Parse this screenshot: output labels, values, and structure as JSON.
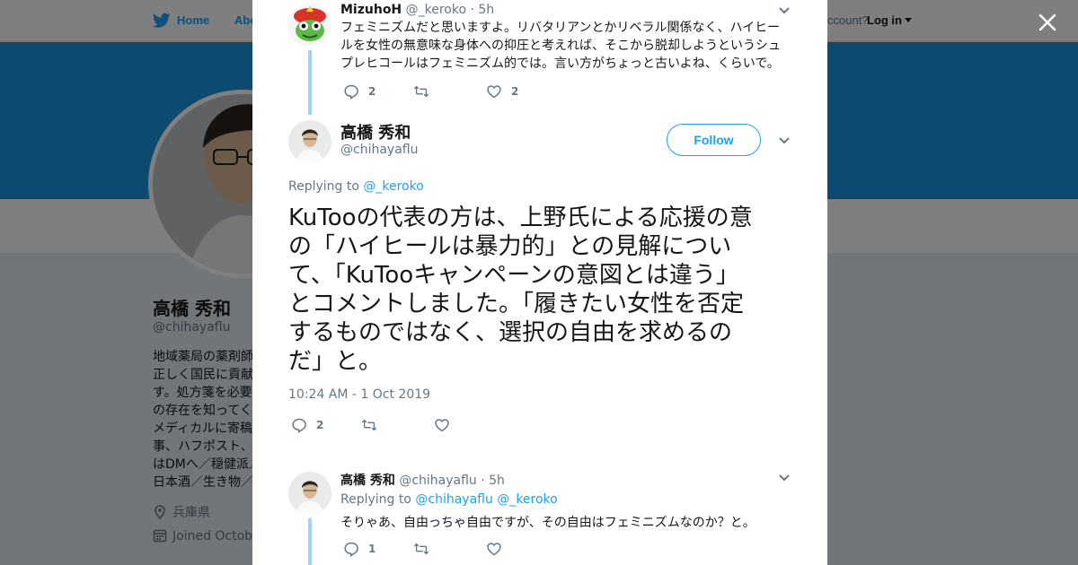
{
  "nav": {
    "home_label": "Home",
    "about_label": "Abo",
    "account_prompt": "ccount?",
    "login_label": "Log in"
  },
  "profile": {
    "name": "高橋 秀和",
    "handle": "@chihayaflu",
    "bio_lines": [
      "地域薬局の薬剤師",
      "正しく国民に貢献",
      "す。処方箋を必要",
      "の存在を知ってく",
      "メディカルに寄稿",
      "事、ハフポスト、",
      "はDMへ／穏健派／",
      "日本酒／生き物／"
    ],
    "location": "兵庫県",
    "joined": "Joined Octobe"
  },
  "thread": {
    "reply1": {
      "name": "MizuhoH",
      "handle": "@_keroko",
      "time": "· 5h",
      "text_lines": [
        "フェミニズムだと思いますよ。リバタリアンとかリベラル関係なく、ハイヒー",
        "ルを女性の無意味な身体への抑圧と考えれば、そこから脱却しようというシュ",
        "プレヒコールはフェミニズム的では。言い方がちょっと古いよね、くらいで。"
      ],
      "reply_count": "2",
      "retweet_count": "",
      "like_count": "2"
    },
    "main": {
      "name": "高橋 秀和",
      "handle": "@chihayaflu",
      "follow_label": "Follow",
      "replying_prefix": "Replying to",
      "replying_to": "@_keroko",
      "text_lines": [
        "KuTooの代表の方は、上野氏による応援の意",
        "の「ハイヒールは暴力的」との見解につい",
        "て、「KuTooキャンペーンの意図とは違う」",
        "とコメントしました。「履きたい女性を否定",
        "するものではなく、選択の自由を求めるの",
        "だ」と。"
      ],
      "timestamp": "10:24 AM - 1 Oct 2019",
      "reply_count": "2",
      "retweet_count": "",
      "like_count": ""
    },
    "reply2": {
      "name": "高橋 秀和",
      "handle": "@chihayaflu",
      "time": "· 5h",
      "replying_prefix": "Replying to",
      "replying_to_1": "@chihayaflu",
      "replying_to_2": "@_keroko",
      "text": "そりゃあ、自由っちゃ自由ですが、その自由はフェミニズムなのか？と。",
      "reply_count": "1",
      "retweet_count": "",
      "like_count": ""
    }
  },
  "colors": {
    "accent": "#1da1f2",
    "banner": "#1b95e0",
    "muted": "#657786",
    "thread_line": "#a3d3f3"
  },
  "icons": [
    "twitter-bird-icon",
    "close-icon",
    "reply-icon",
    "retweet-icon",
    "like-icon",
    "chevron-down-icon",
    "location-icon",
    "calendar-icon"
  ]
}
